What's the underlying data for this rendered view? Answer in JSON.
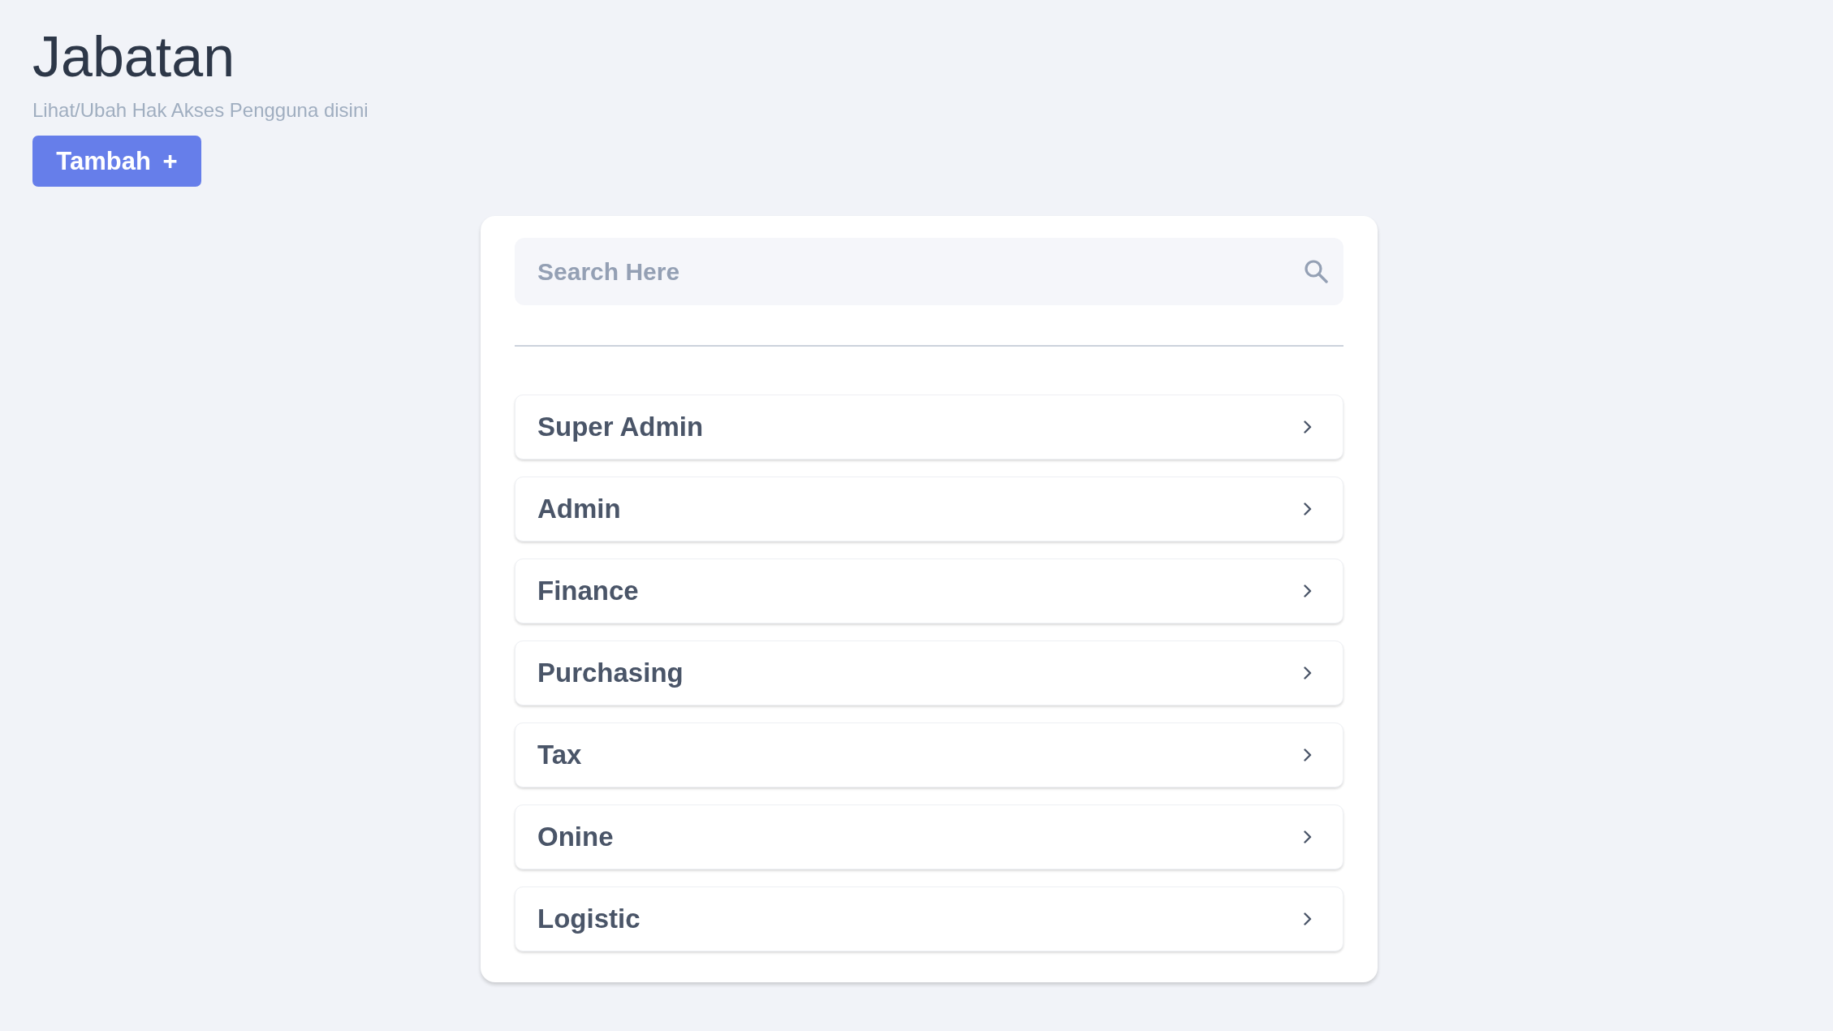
{
  "page": {
    "title": "Jabatan",
    "subtitle": "Lihat/Ubah Hak Akses Pengguna disini"
  },
  "add_button": {
    "label": "Tambah +"
  },
  "search": {
    "placeholder": "Search Here"
  },
  "roles": [
    {
      "name": "Super Admin"
    },
    {
      "name": "Admin"
    },
    {
      "name": "Finance"
    },
    {
      "name": "Purchasing"
    },
    {
      "name": "Tax"
    },
    {
      "name": "Onine"
    },
    {
      "name": "Logistic"
    }
  ]
}
